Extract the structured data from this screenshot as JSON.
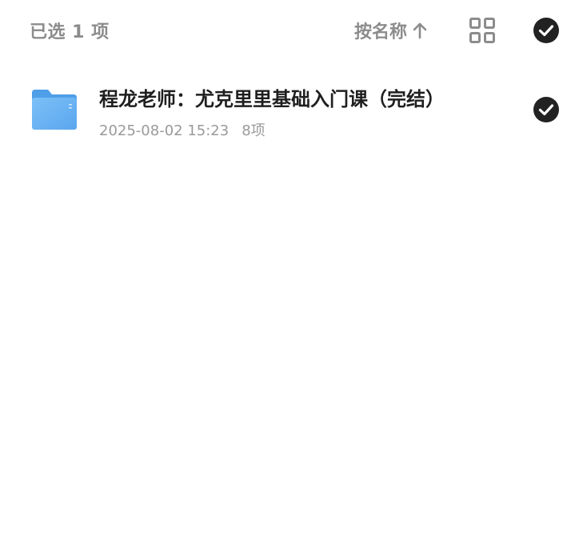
{
  "toolbar": {
    "selected_label": "已选 1 项",
    "sort_label": "按名称",
    "sort_icon": "arrow-up-icon",
    "view_icon": "grid-view-icon",
    "select_all_icon": "check-circle-icon"
  },
  "files": [
    {
      "name": "程龙老师：尤克里里基础入门课（完结）",
      "date": "2025-08-02 15:23",
      "count": "8项",
      "icon": "folder-icon",
      "selected": true
    }
  ],
  "colors": {
    "muted_text": "#8c8c8c",
    "primary_text": "#1f1f1f",
    "meta_text": "#9a9a9a",
    "check_fill": "#222222",
    "folder_blue": "#6fb3f2"
  }
}
